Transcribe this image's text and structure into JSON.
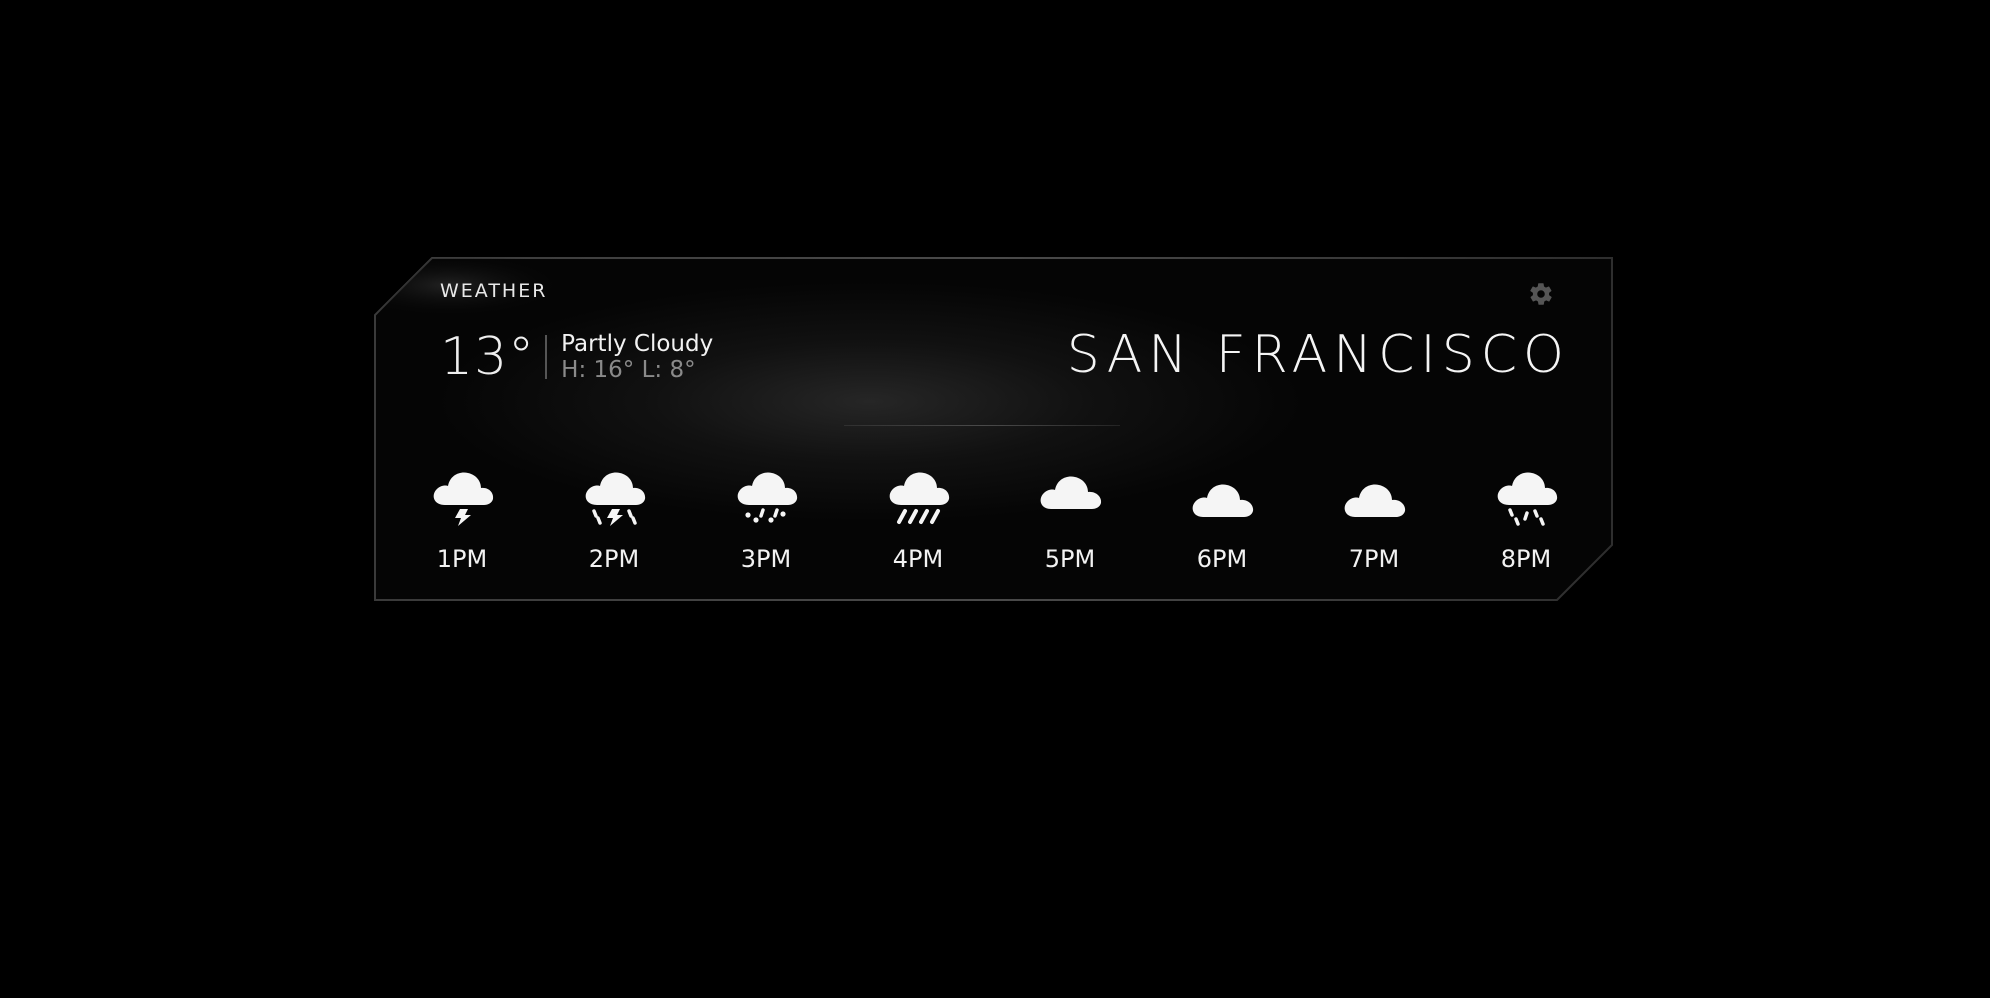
{
  "widget": {
    "title": "WEATHER",
    "settings_icon": "gear-icon",
    "current": {
      "temperature": "13°",
      "condition": "Partly Cloudy",
      "high_low": "H: 16° L: 8°"
    },
    "city": "SAN FRANCISCO"
  },
  "forecast": [
    {
      "time": "1PM",
      "icon": "thunderstorm-icon"
    },
    {
      "time": "2PM",
      "icon": "rain-thunderstorm-icon"
    },
    {
      "time": "3PM",
      "icon": "sleet-icon"
    },
    {
      "time": "4PM",
      "icon": "heavy-rain-icon"
    },
    {
      "time": "5PM",
      "icon": "cloud-icon"
    },
    {
      "time": "6PM",
      "icon": "cloud-icon"
    },
    {
      "time": "7PM",
      "icon": "cloud-icon"
    },
    {
      "time": "8PM",
      "icon": "drizzle-icon"
    }
  ],
  "colors": {
    "background": "#000000",
    "text": "#ffffff",
    "muted_text": "#8a8a8a",
    "border": "#3a3a3a",
    "icon": "#f5f5f5",
    "gear": "#555555"
  }
}
